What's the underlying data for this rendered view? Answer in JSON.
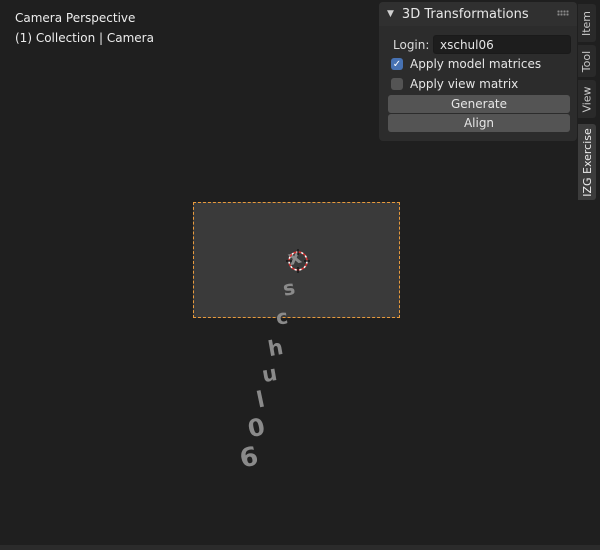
{
  "viewport": {
    "overlay_line1": "Camera Perspective",
    "overlay_line2": "(1) Collection | Camera"
  },
  "scene_text": {
    "chars": [
      "x",
      "s",
      "c",
      "h",
      "u",
      "l",
      "0",
      "6"
    ]
  },
  "panel": {
    "title": "3D Transformations",
    "login_label": "Login:",
    "login_value": "xschul06",
    "apply_model_label": "Apply model matrices",
    "apply_model_checked": true,
    "apply_view_label": "Apply view matrix",
    "apply_view_checked": false,
    "generate_label": "Generate",
    "align_label": "Align"
  },
  "tabs": [
    "Item",
    "Tool",
    "View",
    "IZG Exercise"
  ],
  "colors": {
    "camera_border": "#e89a3c",
    "checkbox_checked": "#4772b3",
    "camera_origin": "#d63030"
  }
}
